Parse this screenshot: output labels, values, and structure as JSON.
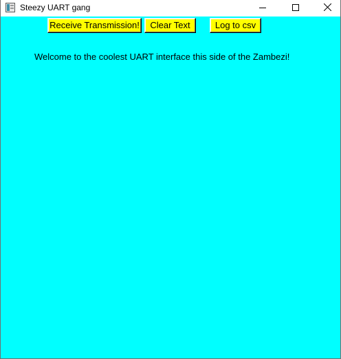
{
  "window": {
    "title": "Steezy UART gang",
    "background_color": "#00ffff",
    "button_color": "#ffff00"
  },
  "toolbar": {
    "receive_label": "Receive Transmission!",
    "clear_label": "Clear Text",
    "log_label": "Log to csv"
  },
  "main": {
    "welcome_text": "Welcome to the coolest UART interface this side of the Zambezi!"
  },
  "icons": {
    "app": "tk-feather-icon",
    "minimize": "minimize-icon",
    "maximize": "maximize-icon",
    "close": "close-icon"
  }
}
